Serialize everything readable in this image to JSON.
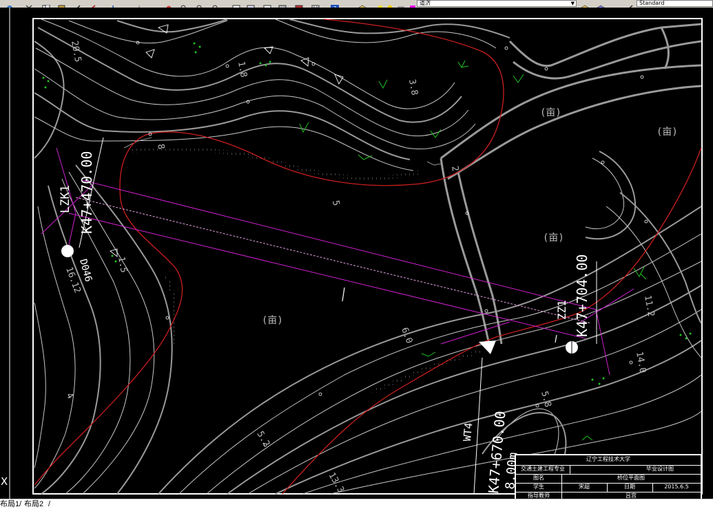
{
  "toolbar": {
    "layer_name": "道济",
    "text_style": "Standard",
    "icons": [
      "globe-icon",
      "cut-icon",
      "copy-icon",
      "paste-icon",
      "match-properties-icon",
      "brush-icon",
      "undo-icon",
      "redo-icon",
      "pan-icon",
      "zoom-realtime-icon",
      "zoom-window-icon",
      "zoom-previous-icon",
      "properties-icon",
      "design-center-icon",
      "tool-palettes-icon",
      "markup-icon",
      "calculator-icon",
      "help-icon",
      "layers-icon",
      "bulb-icon",
      "sun-icon",
      "lock-icon",
      "color-icon",
      "layer-state-icon",
      "layer-previous-icon",
      "text-style-icon"
    ]
  },
  "colors": {
    "background": "#000000",
    "contour_major": "#9a9a9a",
    "contour_minor": "#c8c8c8",
    "road_edge": "#cc1f1f",
    "bridge_line": "#d020d0",
    "vegetation": "#22c022",
    "text": "#ffffff"
  },
  "drawing": {
    "labels": {
      "station_left": "K47+470.00",
      "station_right": "K47+704.00",
      "station_center": "K47+670.00",
      "pier_left": "LZK1",
      "pier_left_b": "D046",
      "pier_right": "ZZ1",
      "pier_center": "WT4",
      "width_center": "8.00m",
      "elev_20_5": "20.5",
      "elev_16_12": "16.12",
      "elev_14_0": "14.0",
      "elev_5_2": "5.2",
      "elev_6_0": "6.0",
      "elev_3_8": "3.8",
      "elev_5_8": "5.8",
      "elev_8": "8",
      "elev_5": "5",
      "elev_11_2": "11.2",
      "elev_4": "4",
      "elev_13_3": "13.3",
      "elev_1_5": "1.5",
      "elev_1_8": "1.8",
      "elev_2": "2",
      "tree_symbol": "(亩)"
    }
  },
  "title_block": {
    "school": "辽宁工程技术大学",
    "major": "交通土建工程专业",
    "design_type": "毕业设计图",
    "drawing_name_label": "图名",
    "drawing_name": "桥位平面图",
    "student_label": "学生",
    "student": "宋超",
    "date_label": "日期",
    "date": "2015.6.5",
    "advisor_label": "指导教师",
    "advisor": "吕宫"
  },
  "layout_tabs": {
    "tab1": "布局1",
    "tab2": "布局2"
  },
  "ucs_axis_label": "X"
}
